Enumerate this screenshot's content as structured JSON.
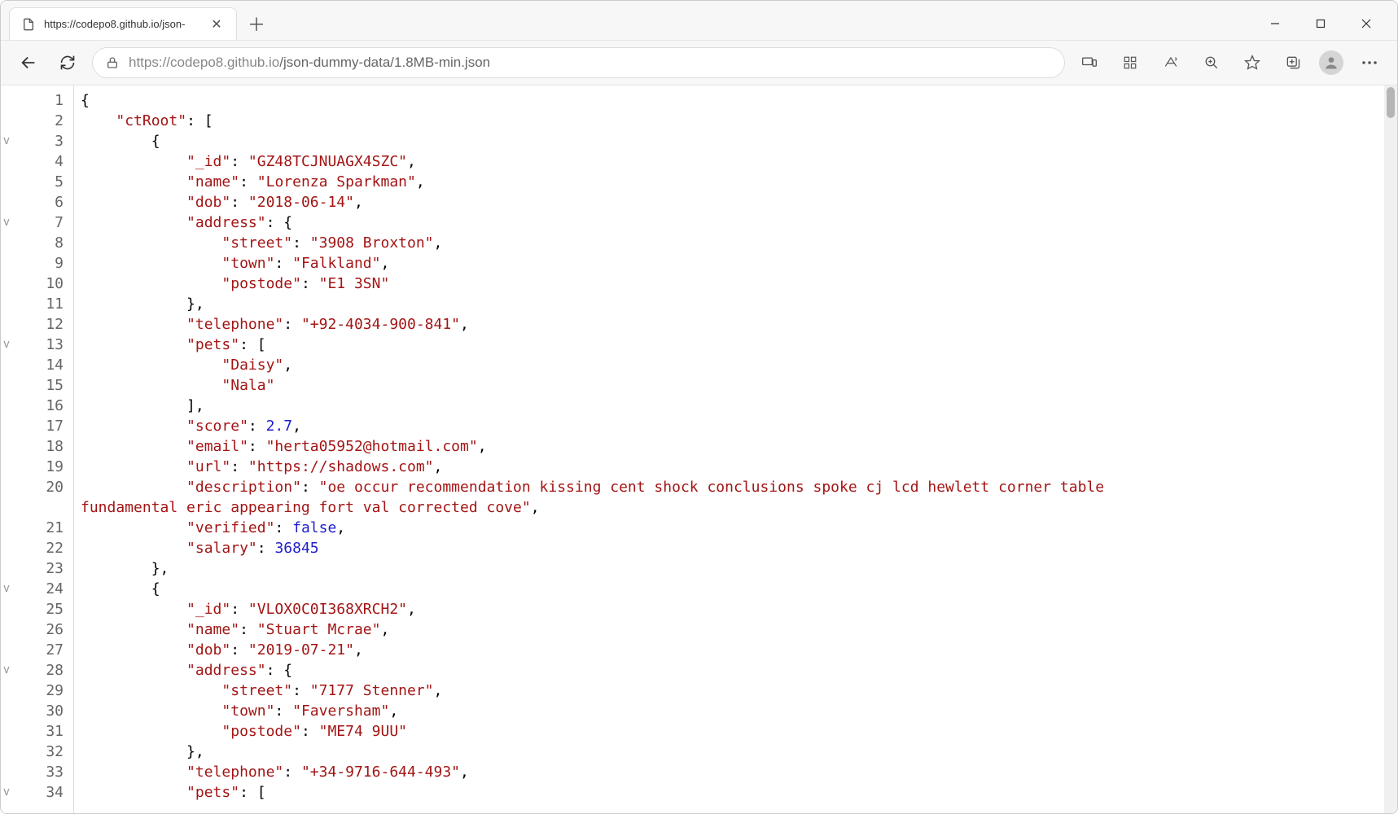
{
  "tab": {
    "title": "https://codepo8.github.io/json-"
  },
  "url": {
    "full": "https://codepo8.github.io/json-dummy-data/1.8MB-min.json",
    "scheme_host": "https://codepo8.github.io",
    "path": "/json-dummy-data/1.8MB-min.json"
  },
  "gutter": {
    "start": 1,
    "end": 34
  },
  "foldMarkers": [
    3,
    7,
    13,
    24,
    28,
    34
  ],
  "json_lines": [
    {
      "indent": 0,
      "tokens": [
        {
          "t": "p",
          "v": "{"
        }
      ]
    },
    {
      "indent": 1,
      "tokens": [
        {
          "t": "k",
          "v": "\"ctRoot\""
        },
        {
          "t": "p",
          "v": ": ["
        }
      ]
    },
    {
      "indent": 2,
      "tokens": [
        {
          "t": "p",
          "v": "{"
        }
      ]
    },
    {
      "indent": 3,
      "tokens": [
        {
          "t": "k",
          "v": "\"_id\""
        },
        {
          "t": "p",
          "v": ": "
        },
        {
          "t": "s",
          "v": "\"GZ48TCJNUAGX4SZC\""
        },
        {
          "t": "p",
          "v": ","
        }
      ]
    },
    {
      "indent": 3,
      "tokens": [
        {
          "t": "k",
          "v": "\"name\""
        },
        {
          "t": "p",
          "v": ": "
        },
        {
          "t": "s",
          "v": "\"Lorenza Sparkman\""
        },
        {
          "t": "p",
          "v": ","
        }
      ]
    },
    {
      "indent": 3,
      "tokens": [
        {
          "t": "k",
          "v": "\"dob\""
        },
        {
          "t": "p",
          "v": ": "
        },
        {
          "t": "s",
          "v": "\"2018-06-14\""
        },
        {
          "t": "p",
          "v": ","
        }
      ]
    },
    {
      "indent": 3,
      "tokens": [
        {
          "t": "k",
          "v": "\"address\""
        },
        {
          "t": "p",
          "v": ": {"
        }
      ]
    },
    {
      "indent": 4,
      "tokens": [
        {
          "t": "k",
          "v": "\"street\""
        },
        {
          "t": "p",
          "v": ": "
        },
        {
          "t": "s",
          "v": "\"3908 Broxton\""
        },
        {
          "t": "p",
          "v": ","
        }
      ]
    },
    {
      "indent": 4,
      "tokens": [
        {
          "t": "k",
          "v": "\"town\""
        },
        {
          "t": "p",
          "v": ": "
        },
        {
          "t": "s",
          "v": "\"Falkland\""
        },
        {
          "t": "p",
          "v": ","
        }
      ]
    },
    {
      "indent": 4,
      "tokens": [
        {
          "t": "k",
          "v": "\"postode\""
        },
        {
          "t": "p",
          "v": ": "
        },
        {
          "t": "s",
          "v": "\"E1 3SN\""
        }
      ]
    },
    {
      "indent": 3,
      "tokens": [
        {
          "t": "p",
          "v": "},"
        }
      ]
    },
    {
      "indent": 3,
      "tokens": [
        {
          "t": "k",
          "v": "\"telephone\""
        },
        {
          "t": "p",
          "v": ": "
        },
        {
          "t": "s",
          "v": "\"+92-4034-900-841\""
        },
        {
          "t": "p",
          "v": ","
        }
      ]
    },
    {
      "indent": 3,
      "tokens": [
        {
          "t": "k",
          "v": "\"pets\""
        },
        {
          "t": "p",
          "v": ": ["
        }
      ]
    },
    {
      "indent": 4,
      "tokens": [
        {
          "t": "s",
          "v": "\"Daisy\""
        },
        {
          "t": "p",
          "v": ","
        }
      ]
    },
    {
      "indent": 4,
      "tokens": [
        {
          "t": "s",
          "v": "\"Nala\""
        }
      ]
    },
    {
      "indent": 3,
      "tokens": [
        {
          "t": "p",
          "v": "],"
        }
      ]
    },
    {
      "indent": 3,
      "tokens": [
        {
          "t": "k",
          "v": "\"score\""
        },
        {
          "t": "p",
          "v": ": "
        },
        {
          "t": "n",
          "v": "2.7"
        },
        {
          "t": "p",
          "v": ","
        }
      ]
    },
    {
      "indent": 3,
      "tokens": [
        {
          "t": "k",
          "v": "\"email\""
        },
        {
          "t": "p",
          "v": ": "
        },
        {
          "t": "s",
          "v": "\"herta05952@hotmail.com\""
        },
        {
          "t": "p",
          "v": ","
        }
      ]
    },
    {
      "indent": 3,
      "tokens": [
        {
          "t": "k",
          "v": "\"url\""
        },
        {
          "t": "p",
          "v": ": "
        },
        {
          "t": "s",
          "v": "\"https://shadows.com\""
        },
        {
          "t": "p",
          "v": ","
        }
      ]
    },
    {
      "indent": 3,
      "wrap": true,
      "tokens": [
        {
          "t": "k",
          "v": "\"description\""
        },
        {
          "t": "p",
          "v": ": "
        },
        {
          "t": "s",
          "v": "\"oe occur recommendation kissing cent shock conclusions spoke cj lcd hewlett corner table fundamental eric appearing fort val corrected cove\""
        },
        {
          "t": "p",
          "v": ","
        }
      ]
    },
    {
      "indent": 3,
      "tokens": [
        {
          "t": "k",
          "v": "\"verified\""
        },
        {
          "t": "p",
          "v": ": "
        },
        {
          "t": "b",
          "v": "false"
        },
        {
          "t": "p",
          "v": ","
        }
      ]
    },
    {
      "indent": 3,
      "tokens": [
        {
          "t": "k",
          "v": "\"salary\""
        },
        {
          "t": "p",
          "v": ": "
        },
        {
          "t": "n",
          "v": "36845"
        }
      ]
    },
    {
      "indent": 2,
      "tokens": [
        {
          "t": "p",
          "v": "},"
        }
      ]
    },
    {
      "indent": 2,
      "tokens": [
        {
          "t": "p",
          "v": "{"
        }
      ]
    },
    {
      "indent": 3,
      "tokens": [
        {
          "t": "k",
          "v": "\"_id\""
        },
        {
          "t": "p",
          "v": ": "
        },
        {
          "t": "s",
          "v": "\"VLOX0C0I368XRCH2\""
        },
        {
          "t": "p",
          "v": ","
        }
      ]
    },
    {
      "indent": 3,
      "tokens": [
        {
          "t": "k",
          "v": "\"name\""
        },
        {
          "t": "p",
          "v": ": "
        },
        {
          "t": "s",
          "v": "\"Stuart Mcrae\""
        },
        {
          "t": "p",
          "v": ","
        }
      ]
    },
    {
      "indent": 3,
      "tokens": [
        {
          "t": "k",
          "v": "\"dob\""
        },
        {
          "t": "p",
          "v": ": "
        },
        {
          "t": "s",
          "v": "\"2019-07-21\""
        },
        {
          "t": "p",
          "v": ","
        }
      ]
    },
    {
      "indent": 3,
      "tokens": [
        {
          "t": "k",
          "v": "\"address\""
        },
        {
          "t": "p",
          "v": ": {"
        }
      ]
    },
    {
      "indent": 4,
      "tokens": [
        {
          "t": "k",
          "v": "\"street\""
        },
        {
          "t": "p",
          "v": ": "
        },
        {
          "t": "s",
          "v": "\"7177 Stenner\""
        },
        {
          "t": "p",
          "v": ","
        }
      ]
    },
    {
      "indent": 4,
      "tokens": [
        {
          "t": "k",
          "v": "\"town\""
        },
        {
          "t": "p",
          "v": ": "
        },
        {
          "t": "s",
          "v": "\"Faversham\""
        },
        {
          "t": "p",
          "v": ","
        }
      ]
    },
    {
      "indent": 4,
      "tokens": [
        {
          "t": "k",
          "v": "\"postode\""
        },
        {
          "t": "p",
          "v": ": "
        },
        {
          "t": "s",
          "v": "\"ME74 9UU\""
        }
      ]
    },
    {
      "indent": 3,
      "tokens": [
        {
          "t": "p",
          "v": "},"
        }
      ]
    },
    {
      "indent": 3,
      "tokens": [
        {
          "t": "k",
          "v": "\"telephone\""
        },
        {
          "t": "p",
          "v": ": "
        },
        {
          "t": "s",
          "v": "\"+34-9716-644-493\""
        },
        {
          "t": "p",
          "v": ","
        }
      ]
    },
    {
      "indent": 3,
      "tokens": [
        {
          "t": "k",
          "v": "\"pets\""
        },
        {
          "t": "p",
          "v": ": ["
        }
      ]
    }
  ]
}
